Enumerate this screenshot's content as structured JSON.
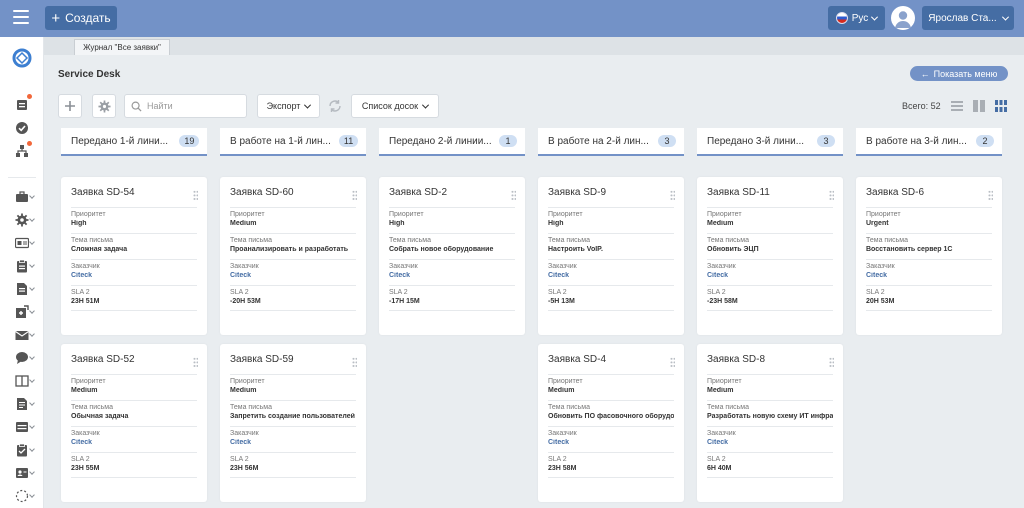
{
  "topbar": {
    "create_label": "Создать",
    "lang_label": "Рус",
    "user_label": "Ярослав Ста..."
  },
  "tab": {
    "label": "Журнал \"Все заявки\""
  },
  "page": {
    "title": "Service Desk",
    "show_menu_label": "Показать меню"
  },
  "toolbar": {
    "search_placeholder": "Найти",
    "export_label": "Экспорт",
    "boards_label": "Список досок",
    "total_label": "Всего: 52"
  },
  "columns": [
    {
      "title": "Передано 1-й лини...",
      "count": "19"
    },
    {
      "title": "В работе на 1-й лин...",
      "count": "11"
    },
    {
      "title": "Передано 2-й линии...",
      "count": "1"
    },
    {
      "title": "В работе на 2-й лин...",
      "count": "3"
    },
    {
      "title": "Передано 3-й лини...",
      "count": "3"
    },
    {
      "title": "В работе на 3-й лин...",
      "count": "2"
    }
  ],
  "field_labels": {
    "priority": "Приоритет",
    "subject": "Тема письма",
    "customer": "Заказчик",
    "sla": "SLA 2"
  },
  "cards": [
    {
      "title": "Заявка SD-54",
      "priority": "High",
      "subject": "Сложная задача",
      "customer": "Citeck",
      "sla": "23H 51M"
    },
    {
      "title": "Заявка SD-60",
      "priority": "Medium",
      "subject": "Проанализировать и разработать",
      "customer": "Citeck",
      "sla": "-20H 53M"
    },
    {
      "title": "Заявка SD-2",
      "priority": "High",
      "subject": "Собрать новое оборудование",
      "customer": "Citeck",
      "sla": "-17H 15M"
    },
    {
      "title": "Заявка SD-9",
      "priority": "High",
      "subject": "Настроить VoIP.",
      "customer": "Citeck",
      "sla": "-5H 13M"
    },
    {
      "title": "Заявка SD-11",
      "priority": "Medium",
      "subject": "Обновить ЭЦП",
      "customer": "Citeck",
      "sla": "-23H 58M"
    },
    {
      "title": "Заявка SD-6",
      "priority": "Urgent",
      "subject": "Восстановить сервер 1С",
      "customer": "Citeck",
      "sla": "20H 53M"
    },
    {
      "title": "Заявка SD-52",
      "priority": "Medium",
      "subject": "Обычная задача",
      "customer": "Citeck",
      "sla": "23H 55M"
    },
    {
      "title": "Заявка SD-59",
      "priority": "Medium",
      "subject": "Запретить создание пользователей",
      "customer": "Citeck",
      "sla": "23H 56M"
    },
    {
      "title": "Заявка SD-4",
      "priority": "Medium",
      "subject": "Обновить ПО фасовочного оборудования",
      "customer": "Citeck",
      "sla": "23H 58M"
    },
    {
      "title": "Заявка SD-8",
      "priority": "Medium",
      "subject": "Разработать новую схему ИТ инфраструктуры",
      "customer": "Citeck",
      "sla": "6H 40M"
    }
  ],
  "colors": {
    "topbar": "#7392c7",
    "button": "#456da4",
    "accent": "#456da4",
    "badge": "#cfdff3",
    "notification": "#f2673a"
  }
}
